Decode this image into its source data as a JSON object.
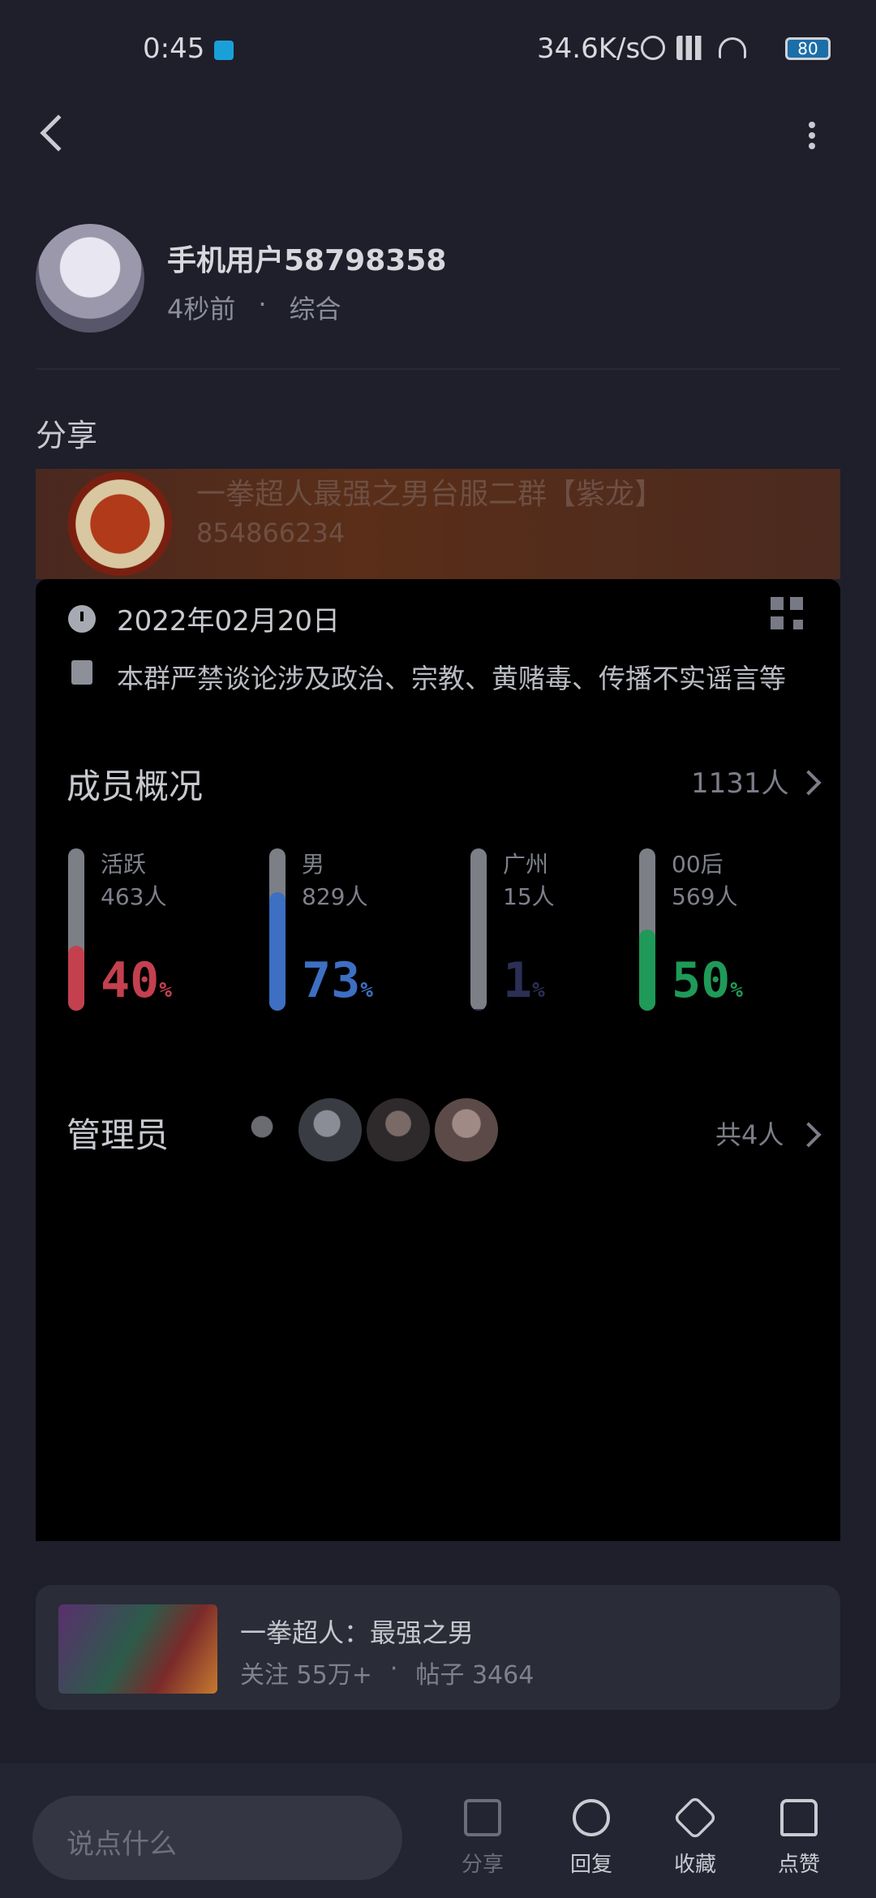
{
  "status": {
    "time": "0:45",
    "speed": "34.6K/s",
    "battery": "80"
  },
  "post": {
    "author": "手机用户58798358",
    "time_ago": "4秒前",
    "dot": "·",
    "category": "综合",
    "body_text": "分享"
  },
  "group": {
    "name": "一拳超人最强之男台服二群【紫龙】",
    "id": "854866234",
    "date": "2022年02月20日",
    "rule": "本群严禁谈论涉及政治、宗教、黄赌毒、传播不实谣言等",
    "members_title": "成员概况",
    "members_count": "1131人",
    "stats": [
      {
        "label": "活跃",
        "count": "463人",
        "pct": "40",
        "unit": "%",
        "color": "#c4404f"
      },
      {
        "label": "男",
        "count": "829人",
        "pct": "73",
        "unit": "%",
        "color": "#3d6fc2"
      },
      {
        "label": "广州",
        "count": "15人",
        "pct": "1",
        "unit": "%",
        "color": "#2b2f55"
      },
      {
        "label": "00后",
        "count": "569人",
        "pct": "50",
        "unit": "%",
        "color": "#1f9a58"
      }
    ],
    "admin_title": "管理员",
    "admin_count": "共4人"
  },
  "game": {
    "name": "一拳超人：最强之男",
    "follow": "关注 55万+",
    "dot": "·",
    "posts": "帖子 3464"
  },
  "bottom": {
    "placeholder": "说点什么",
    "share": "分享",
    "reply": "回复",
    "favorite": "收藏",
    "like": "点赞"
  }
}
